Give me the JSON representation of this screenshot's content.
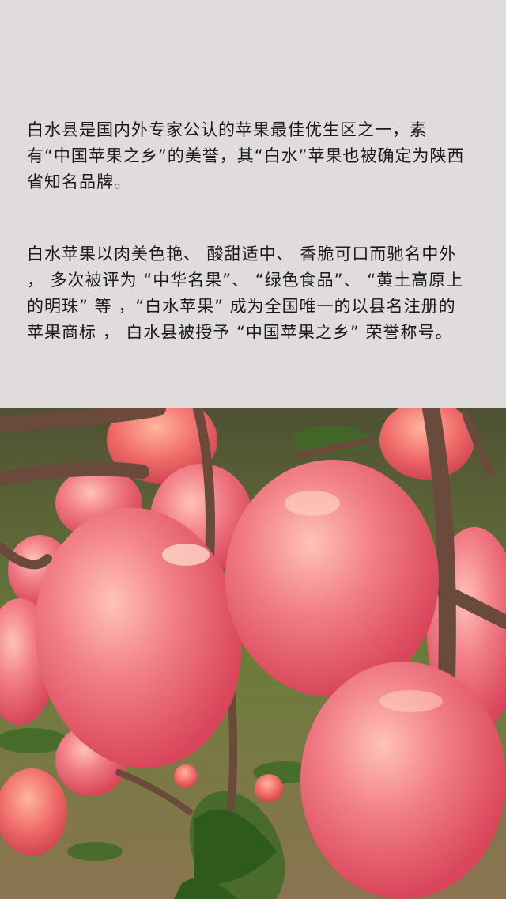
{
  "content": {
    "paragraph_1": "白水县是国内外专家公认的苹果最佳优生区之一，素有“中国苹果之乡”的美誉，其“白水”苹果也被确定为陕西省知名品牌。",
    "paragraph_2": "白水苹果以肉美色艳、 酸甜适中、 香脆可口而驰名中外 ， 多次被评为 “中华名果”、 “绿色食品”、 “黄土高原上的明珠” 等 ，“白水苹果” 成为全国唯一的以县名注册的苹果商标 ， 白水县被授予 “中国苹果之乡” 荣誉称号。"
  },
  "photo": {
    "subject": "apples-on-tree-photo",
    "colors": {
      "apple": "#f07a84",
      "apple_highlight": "#ffc2b8",
      "leaf": "#3f6a26",
      "branch": "#6a4a3a",
      "background": "#e0dcdb"
    }
  }
}
